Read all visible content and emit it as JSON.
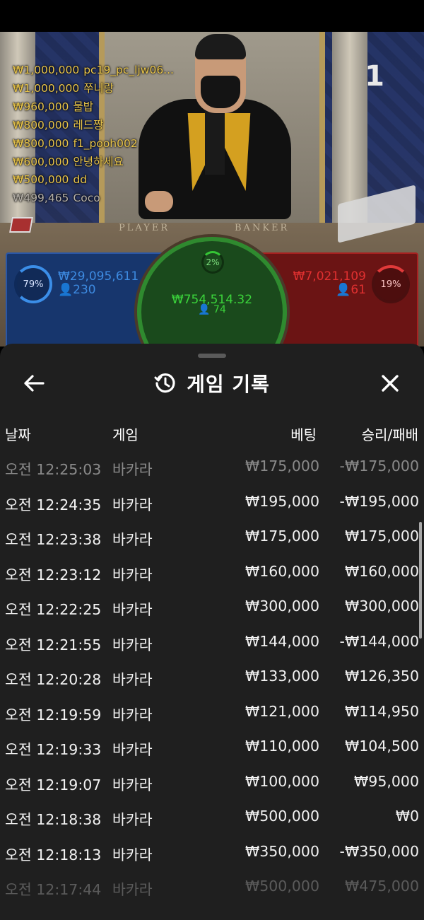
{
  "video": {
    "round_number": "1",
    "table_labels": {
      "player": "PLAYER",
      "banker": "BANKER"
    },
    "leaderboard": [
      {
        "amount": "₩1,000,000",
        "name": "pc19_pc_ljw06...",
        "dim": false
      },
      {
        "amount": "₩1,000,000",
        "name": "쭈니랑",
        "dim": false
      },
      {
        "amount": "₩960,000",
        "name": "물밥",
        "dim": false
      },
      {
        "amount": "₩800,000",
        "name": "레드짱",
        "dim": false
      },
      {
        "amount": "₩800,000",
        "name": "f1_pooh002",
        "dim": false
      },
      {
        "amount": "₩600,000",
        "name": "안녕하세요",
        "dim": false
      },
      {
        "amount": "₩500,000",
        "name": "dd",
        "dim": false
      },
      {
        "amount": "₩499,465",
        "name": "Coco",
        "dim": true
      }
    ],
    "player_zone": {
      "percent": "79%",
      "amount": "₩29,095,611",
      "count": "230",
      "color": "#3d8ae0"
    },
    "banker_zone": {
      "percent": "19%",
      "amount": "₩7,021,109",
      "count": "61",
      "color": "#e03030"
    },
    "tie_zone": {
      "percent": "2%",
      "amount": "₩754,514.32",
      "count": "74",
      "color": "#3bd43b"
    }
  },
  "sheet": {
    "title": "게임 기록",
    "icons": {
      "back": "arrow-left-icon",
      "history": "history-clock-icon",
      "close": "close-x-icon"
    },
    "columns": {
      "date": "날짜",
      "game": "게임",
      "bet": "베팅",
      "result": "승리/패배"
    },
    "rows": [
      {
        "date": "오전 12:25:03",
        "game": "바카라",
        "bet": "₩175,000",
        "result": "-₩175,000"
      },
      {
        "date": "오전 12:24:35",
        "game": "바카라",
        "bet": "₩195,000",
        "result": "-₩195,000"
      },
      {
        "date": "오전 12:23:38",
        "game": "바카라",
        "bet": "₩175,000",
        "result": "₩175,000"
      },
      {
        "date": "오전 12:23:12",
        "game": "바카라",
        "bet": "₩160,000",
        "result": "₩160,000"
      },
      {
        "date": "오전 12:22:25",
        "game": "바카라",
        "bet": "₩300,000",
        "result": "₩300,000"
      },
      {
        "date": "오전 12:21:55",
        "game": "바카라",
        "bet": "₩144,000",
        "result": "-₩144,000"
      },
      {
        "date": "오전 12:20:28",
        "game": "바카라",
        "bet": "₩133,000",
        "result": "₩126,350"
      },
      {
        "date": "오전 12:19:59",
        "game": "바카라",
        "bet": "₩121,000",
        "result": "₩114,950"
      },
      {
        "date": "오전 12:19:33",
        "game": "바카라",
        "bet": "₩110,000",
        "result": "₩104,500"
      },
      {
        "date": "오전 12:19:07",
        "game": "바카라",
        "bet": "₩100,000",
        "result": "₩95,000"
      },
      {
        "date": "오전 12:18:38",
        "game": "바카라",
        "bet": "₩500,000",
        "result": "₩0"
      },
      {
        "date": "오전 12:18:13",
        "game": "바카라",
        "bet": "₩350,000",
        "result": "-₩350,000"
      },
      {
        "date": "오전 12:17:44",
        "game": "바카라",
        "bet": "₩500,000",
        "result": "₩475,000"
      }
    ]
  }
}
